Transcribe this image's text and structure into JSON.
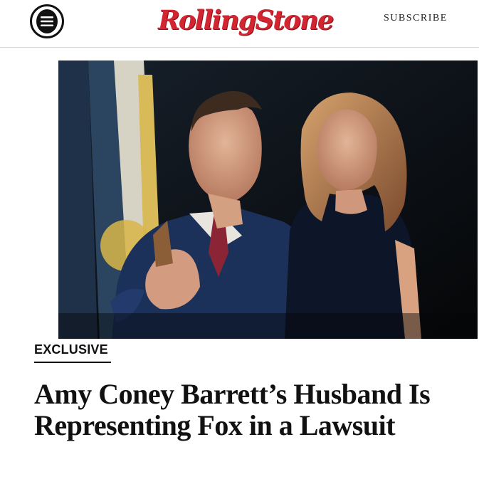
{
  "site": {
    "logo_text": "RollingStone",
    "subscribe_label": "SUBSCRIBE"
  },
  "article": {
    "category": "EXCLUSIVE",
    "headline": "Amy Coney Barrett’s Husband Is Representing Fox in a Lawsuit"
  },
  "icons": {
    "menu": "hamburger-menu-icon"
  },
  "colors": {
    "brand_red": "#d32531",
    "text": "#111111",
    "divider": "#d6d6d6"
  }
}
